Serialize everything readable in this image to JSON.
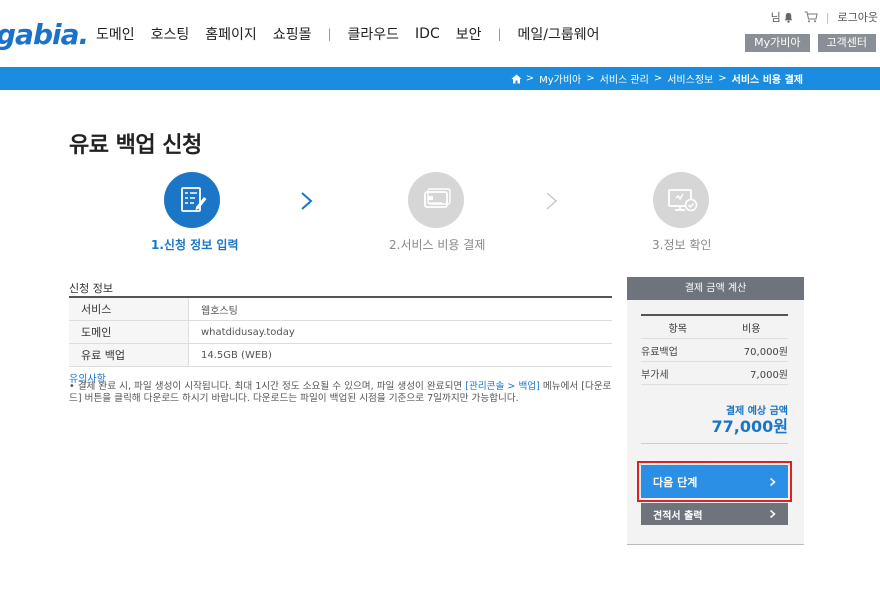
{
  "header": {
    "logo": "gabia.",
    "gnb": [
      "도메인",
      "호스팅",
      "홈페이지",
      "쇼핑몰",
      "클라우드",
      "IDC",
      "보안",
      "메일/그룹웨어"
    ],
    "user_suffix": "님",
    "logout": "로그아웃",
    "my_gabia": "My가비아",
    "support": "고객센터"
  },
  "breadcrumb": [
    "My가비아",
    "서비스 관리",
    "서비스정보",
    "서비스 비용 결제"
  ],
  "page_title": "유료 백업 신청",
  "steps": [
    {
      "label": "1.신청 정보 입력",
      "state": "active"
    },
    {
      "label": "2.서비스 비용 결제",
      "state": "inactive"
    },
    {
      "label": "3.정보 확인",
      "state": "inactive"
    }
  ],
  "info": {
    "section_title": "신청 정보",
    "rows": [
      {
        "label": "서비스",
        "value": "웹호스팅"
      },
      {
        "label": "도메인",
        "value": "whatdidusay.today"
      },
      {
        "label": "유료 백업",
        "value": "14.5GB (WEB)"
      }
    ]
  },
  "notice": {
    "title": "유의사항",
    "text_before": "• 결제 완료 시, 파일 생성이 시작됩니다. 최대 1시간 정도 소요될 수 있으며, 파일 생성이 완료되면 ",
    "link": "[관리콘솔 > 백업]",
    "text_after": " 메뉴에서 [다운로드] 버튼을 클릭해 다운로드 하시기 바랍니다. 다운로드는 파일이 백업된 시점을 기준으로 7일까지만 가능합니다."
  },
  "payment": {
    "head": "결제 금액 계산",
    "col_item": "항목",
    "col_cost": "비용",
    "rows": [
      {
        "label": "유료백업",
        "value": "70,000원"
      },
      {
        "label": "부가세",
        "value": "7,000원"
      }
    ],
    "total_label": "결제 예상 금액",
    "total": "77,000원",
    "next_button": "다음 단계",
    "quote_button": "견적서 출력"
  },
  "colors": {
    "brand_blue": "#1a8de0",
    "active_step": "#1b76c8",
    "next_button": "#2b8fe6",
    "highlight_border": "#e02020"
  }
}
